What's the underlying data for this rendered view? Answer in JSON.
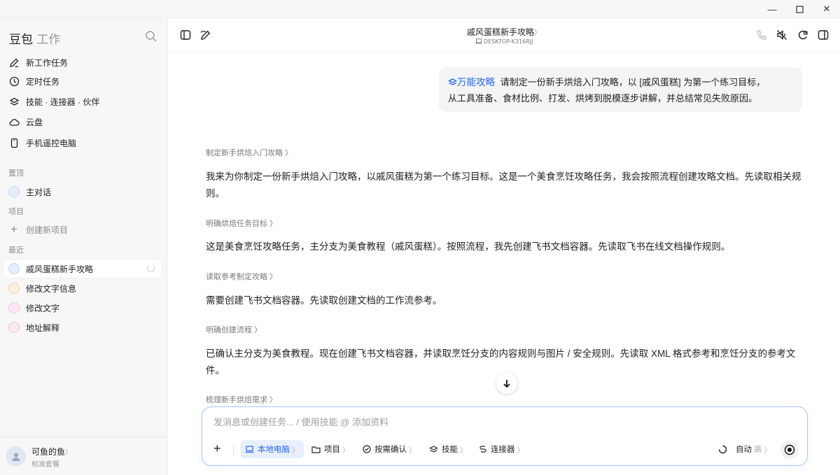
{
  "window": {
    "min_label": "—",
    "max_label": "☐",
    "close_label": "✕"
  },
  "sidebar": {
    "brand": "豆包",
    "brand_sub": "工作",
    "nav": [
      {
        "label": "新工作任务",
        "icon": "edit-icon"
      },
      {
        "label": "定时任务",
        "icon": "clock-icon"
      },
      {
        "label": "技能 · 连接器 · 伙伴",
        "icon": "layers-icon"
      },
      {
        "label": "云盘",
        "icon": "cloud-icon"
      },
      {
        "label": "手机遥控电脑",
        "icon": "phone-icon"
      }
    ],
    "pinned_label": "置顶",
    "pinned_item": "主对话",
    "projects_label": "项目",
    "new_project": "创建新项目",
    "recent_label": "最近",
    "recent": [
      {
        "label": "戚风蛋糕新手攻略",
        "active": true
      },
      {
        "label": "修改文字信息",
        "active": false
      },
      {
        "label": "修改文字",
        "active": false
      },
      {
        "label": "地址解释",
        "active": false
      }
    ],
    "user_name": "可鱼的鱼",
    "user_name_chevron": "〉",
    "user_plan": "标准套餐"
  },
  "header": {
    "title": "戚风蛋糕新手攻略",
    "title_chevron": "〉",
    "device": "DESKTOP-K316RJJ"
  },
  "chat": {
    "user_tag": "万能攻略",
    "user_message_line1": "请制定一份新手烘焙入门攻略，以 [戚风蛋糕] 为第一个练习目标，",
    "user_message_line2": "从工具准备、食材比例、打发、烘烤到脱模逐步讲解，并总结常见失败原因。",
    "steps": [
      {
        "label": "制定新手烘焙入门攻略 〉",
        "text": "我来为你制定一份新手烘焙入门攻略，以戚风蛋糕为第一个练习目标。这是一个美食烹饪攻略任务，我会按照流程创建攻略文档。先读取相关规则。"
      },
      {
        "label": "明确烘焙任务目标 〉",
        "text": "这是美食烹饪攻略任务，主分支为美食教程（戚风蛋糕）。按照流程，我先创建飞书文档容器。先读取飞书在线文档操作规则。"
      },
      {
        "label": "读取参考制定攻略 〉",
        "text": "需要创建飞书文档容器。先读取创建文档的工作流参考。"
      },
      {
        "label": "明确创建流程 〉",
        "text": "已确认主分支为美食教程。现在创建飞书文档容器，并读取烹饪分支的内容规则与图片 / 安全规则。先读取 XML 格式参考和烹饪分支的参考文件。"
      },
      {
        "label": "梳理新手烘焙需求 〉",
        "text": ""
      }
    ]
  },
  "composer": {
    "placeholder": "发消息或创建任务... / 使用技能 @ 添加资料",
    "tools": {
      "local": "本地电脑",
      "project": "项目",
      "confirm": "按需确认",
      "skills": "技能",
      "connectors": "连接器",
      "mode": "自动",
      "level": "高"
    },
    "chevron": "〉",
    "plus": "+"
  },
  "colors": {
    "accent": "#2468f2",
    "sidebar_bg": "#f7f7f8",
    "bubble_bg": "#f3f4f6"
  }
}
